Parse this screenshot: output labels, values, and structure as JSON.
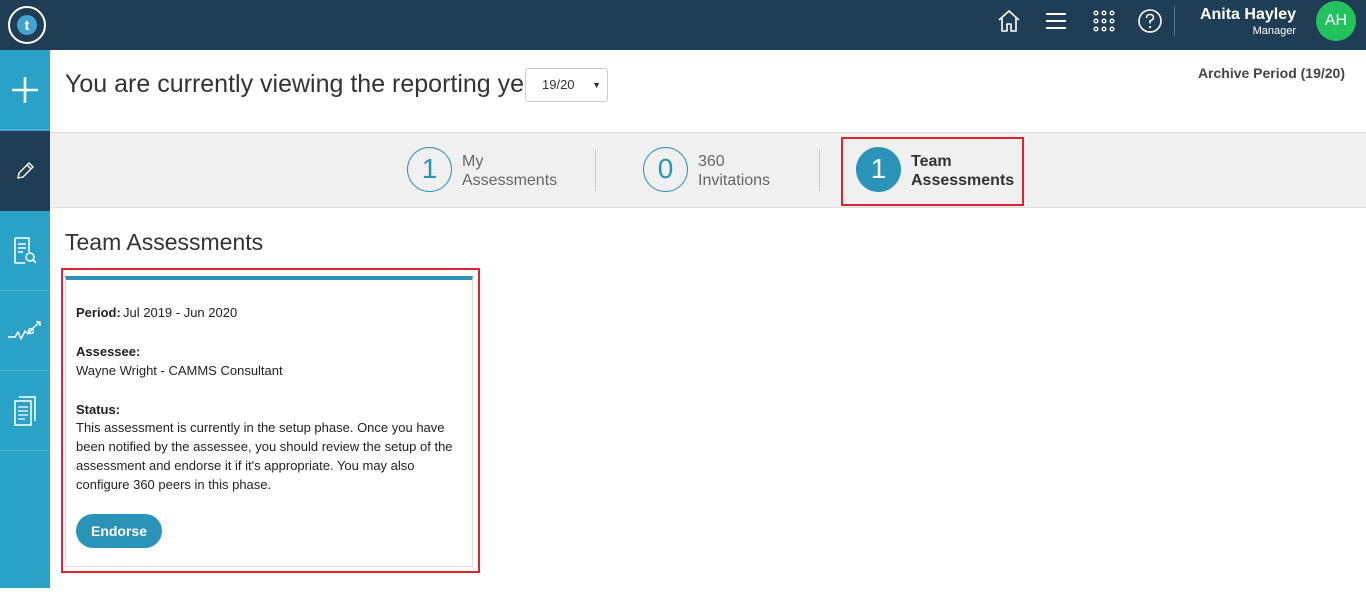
{
  "header": {
    "logo_letter": "t",
    "user_name": "Anita Hayley",
    "user_role": "Manager",
    "avatar_initials": "AH",
    "icons": [
      "home-icon",
      "menu-icon",
      "apps-grid-icon",
      "help-icon"
    ]
  },
  "sidebar": {
    "items": [
      {
        "icon": "plus-icon"
      },
      {
        "icon": "pencil-icon"
      },
      {
        "icon": "document-search-icon"
      },
      {
        "icon": "trend-chart-icon"
      },
      {
        "icon": "documents-icon"
      }
    ]
  },
  "reporting": {
    "label": "You are currently viewing the reporting year",
    "selected_year": "19/20",
    "archive_label": "Archive Period (19/20)"
  },
  "tabs": [
    {
      "count": "1",
      "line1": "My",
      "line2": "Assessments"
    },
    {
      "count": "0",
      "line1": "360",
      "line2": "Invitations"
    },
    {
      "count": "1",
      "line1": "Team",
      "line2": "Assessments"
    }
  ],
  "section_title": "Team Assessments",
  "card": {
    "period_label": "Period:",
    "period_value": "Jul 2019 - Jun 2020",
    "assessee_label": "Assessee:",
    "assessee_value": "Wayne Wright - CAMMS Consultant",
    "status_label": "Status:",
    "status_value": "This assessment is currently in the setup phase. Once you have been notified by the assessee, you should review the setup of the assessment and endorse it if it's appropriate. You may also configure 360 peers in this phase.",
    "endorse_label": "Endorse"
  },
  "colors": {
    "topbar": "#1f3d55",
    "sidebar": "#2aa1c6",
    "accent": "#2a93b8",
    "avatar": "#22c35e",
    "highlight": "#e0222f"
  }
}
